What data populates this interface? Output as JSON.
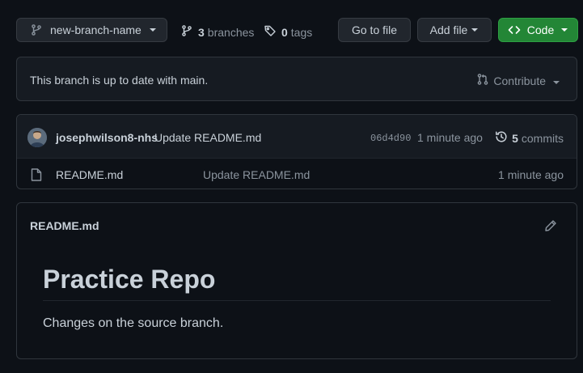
{
  "toolbar": {
    "branch_name": "new-branch-name",
    "branches_count": "3",
    "branches_label": "branches",
    "tags_count": "0",
    "tags_label": "tags",
    "goto_file_label": "Go to file",
    "add_file_label": "Add file",
    "code_label": "Code"
  },
  "status": {
    "message": "This branch is up to date with main.",
    "contribute_label": "Contribute"
  },
  "latest_commit": {
    "author": "josephwilson8-nhs",
    "message": "Update README.md",
    "sha": "06d4d90",
    "time": "1 minute ago",
    "commits_count": "5",
    "commits_label": "commits"
  },
  "files": [
    {
      "name": "README.md",
      "commit_message": "Update README.md",
      "time": "1 minute ago"
    }
  ],
  "readme": {
    "filename": "README.md",
    "heading": "Practice Repo",
    "paragraph": "Changes on the source branch."
  },
  "colors": {
    "background": "#0d1117",
    "surface": "#161b22",
    "border": "#30363d",
    "primary_button": "#238636",
    "text": "#c9d1d9",
    "muted_text": "#8b949e"
  },
  "icons": {
    "branch": "git-branch-icon",
    "tag": "tag-icon",
    "caret": "caret-down-icon",
    "code": "code-brackets-icon",
    "contribute": "pull-request-icon",
    "history": "history-icon",
    "file": "file-icon",
    "edit": "pencil-icon"
  }
}
